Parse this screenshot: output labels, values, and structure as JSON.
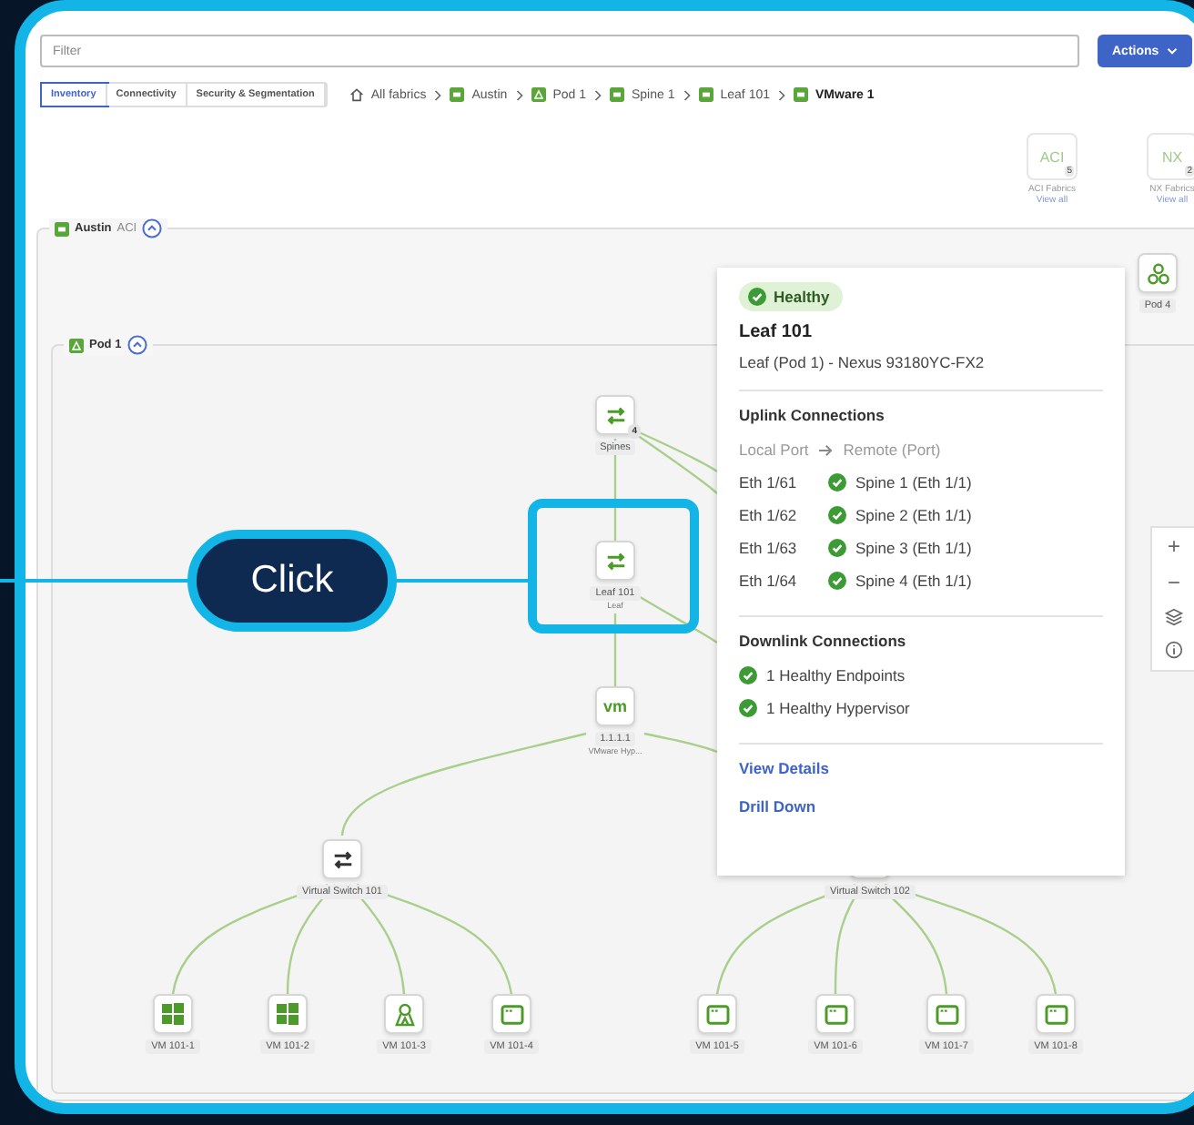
{
  "filter": {
    "placeholder": "Filter"
  },
  "actions_button": {
    "label": "Actions"
  },
  "tabs": [
    {
      "label": "Inventory",
      "selected": true
    },
    {
      "label": "Connectivity",
      "selected": false
    },
    {
      "label": "Security & Segmentation",
      "selected": false
    }
  ],
  "breadcrumb": [
    {
      "label": "All fabrics",
      "kind": "home",
      "selected": false
    },
    {
      "label": "Austin",
      "kind": "fabric",
      "selected": false
    },
    {
      "label": "Pod 1",
      "kind": "pod",
      "selected": false
    },
    {
      "label": "Spine 1",
      "kind": "spine",
      "selected": false
    },
    {
      "label": "Leaf 101",
      "kind": "leaf",
      "selected": false
    },
    {
      "label": "VMware 1",
      "kind": "vmware",
      "selected": true
    }
  ],
  "fabric_tiles": [
    {
      "code": "ACI",
      "count": "5",
      "label": "ACI Fabrics",
      "link": "View all"
    },
    {
      "code": "NX",
      "count": "2",
      "label": "NX Fabrics",
      "link": "View all"
    }
  ],
  "groups": [
    {
      "name": "Austin",
      "type": "ACI",
      "expanded": true
    },
    {
      "name": "Pod 1",
      "expanded": true
    }
  ],
  "nodes": [
    {
      "kind": "switch",
      "label": "Spines",
      "badge": "4"
    },
    {
      "kind": "switch",
      "label": "Leaf 101",
      "sublabel": "Leaf"
    },
    {
      "kind": "hypervisor",
      "icon_text": "vm",
      "label": "1.1.1.1",
      "sublabel": "VMware Hyp..."
    },
    {
      "kind": "vswitch",
      "label": "Virtual Switch 101"
    },
    {
      "kind": "vswitch_hidden",
      "label": "Virtual Switch 102"
    },
    {
      "kind": "windows",
      "label": "VM 101-1"
    },
    {
      "kind": "windows",
      "label": "VM 101-2"
    },
    {
      "kind": "linux",
      "label": "VM 101-3"
    },
    {
      "kind": "app",
      "label": "VM 101-4"
    },
    {
      "kind": "app",
      "label": "VM 101-5"
    },
    {
      "kind": "app",
      "label": "VM 101-6"
    },
    {
      "kind": "app",
      "label": "VM 101-7"
    },
    {
      "kind": "app",
      "label": "VM 101-8"
    },
    {
      "kind": "pod",
      "label": "Pod 4"
    }
  ],
  "popover": {
    "status": "Healthy",
    "title": "Leaf 101",
    "subtitle": "Leaf (Pod 1) - Nexus 93180YC-FX2",
    "uplink_heading": "Uplink Connections",
    "local_header": "Local Port",
    "remote_header": "Remote (Port)",
    "uplinks": [
      {
        "local": "Eth 1/61",
        "remote": "Spine 1 (Eth 1/1)"
      },
      {
        "local": "Eth 1/62",
        "remote": "Spine 2 (Eth 1/1)"
      },
      {
        "local": "Eth 1/63",
        "remote": "Spine 3 (Eth 1/1)"
      },
      {
        "local": "Eth 1/64",
        "remote": "Spine 4 (Eth 1/1)"
      }
    ],
    "downlink_heading": "Downlink Connections",
    "downlinks": [
      "1 Healthy Endpoints",
      "1 Healthy Hypervisor"
    ],
    "links": [
      "View Details",
      "Drill Down"
    ]
  },
  "zoom_controls": [
    "+",
    "−"
  ],
  "callout": {
    "label": "Click"
  }
}
